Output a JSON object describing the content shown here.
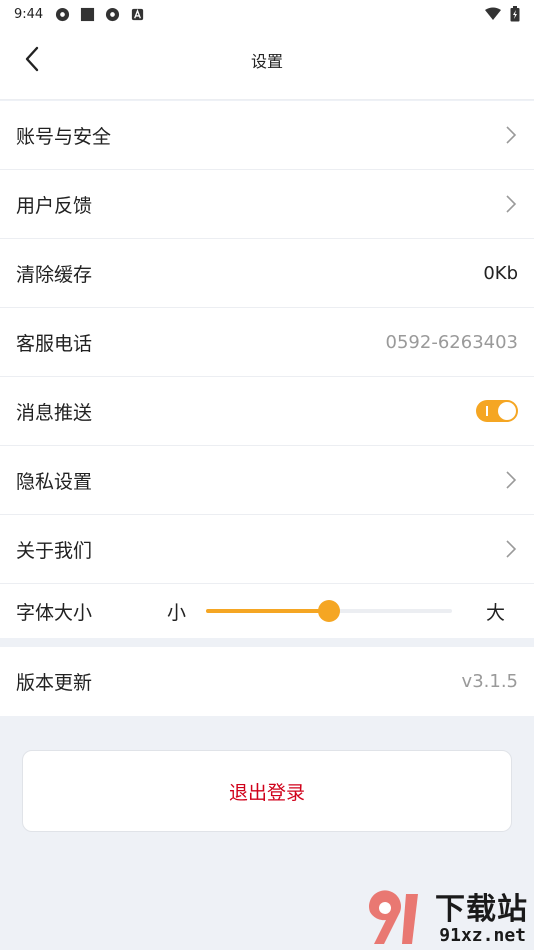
{
  "status_bar": {
    "time": "9:44",
    "icons": [
      "settings-gear-icon",
      "square-icon",
      "settings-gear-icon",
      "a-badge-icon"
    ],
    "right_icons": [
      "wifi-icon",
      "battery-icon"
    ]
  },
  "header": {
    "title": "设置",
    "back_icon": "chevron-left-icon"
  },
  "settings": {
    "account": {
      "label": "账号与安全"
    },
    "feedback": {
      "label": "用户反馈"
    },
    "cache": {
      "label": "清除缓存",
      "value": "0Kb"
    },
    "phone": {
      "label": "客服电话",
      "value": "0592-6263403"
    },
    "push": {
      "label": "消息推送",
      "enabled": true
    },
    "privacy": {
      "label": "隐私设置"
    },
    "about": {
      "label": "关于我们"
    },
    "font_size": {
      "label": "字体大小",
      "min_label": "小",
      "max_label": "大",
      "level": 0.5
    },
    "version": {
      "label": "版本更新",
      "value": "v3.1.5"
    }
  },
  "logout": {
    "label": "退出登录"
  },
  "watermark": {
    "top": "下载站",
    "bottom": "91xz.net"
  },
  "colors": {
    "accent": "#f5a623",
    "danger": "#d0021b",
    "background": "#eef1f6"
  }
}
